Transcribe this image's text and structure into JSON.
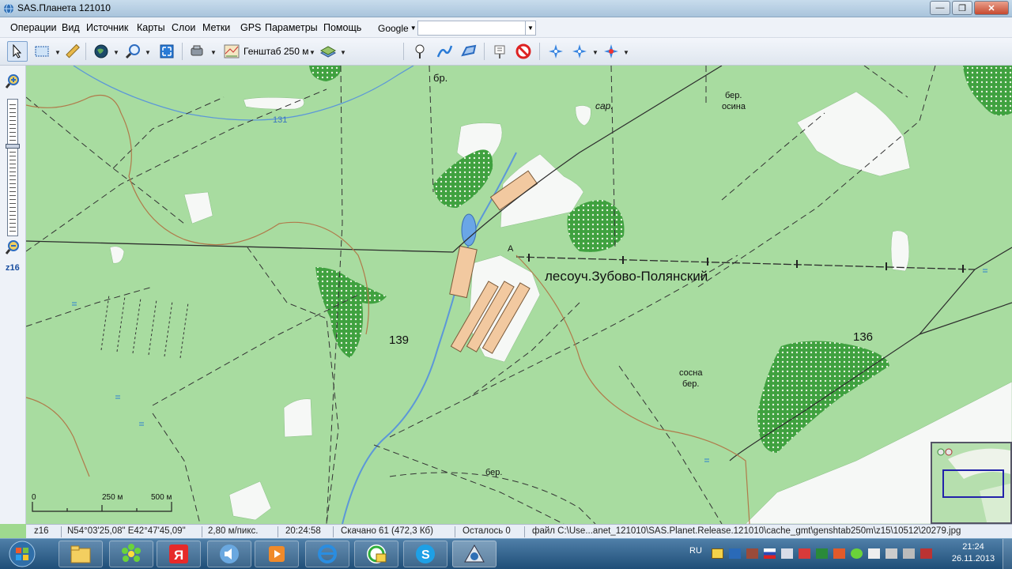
{
  "window": {
    "title": "SAS.Планета 121010"
  },
  "menu": {
    "items": [
      "Операции",
      "Вид",
      "Источник",
      "Карты",
      "Слои",
      "Метки",
      "GPS",
      "Параметры",
      "Помощь"
    ],
    "map_source": "Google",
    "search_value": ""
  },
  "toolbar": {
    "map_name": "Генштаб 250 м"
  },
  "zoom_panel": {
    "level": "z16"
  },
  "map": {
    "labels": {
      "br": "бр.",
      "sar": "сар.",
      "ber_osina_1": "бер.",
      "ber_osina_2": "осина",
      "num131": "131",
      "forestry": "лесоуч.Зубово-Полянский",
      "num139": "139",
      "num136": "136",
      "sosna_ber_1": "сосна",
      "sosna_ber_2": "бер.",
      "ber_bottom": "бер.",
      "marker_a": "А"
    },
    "scale": {
      "s0": "0",
      "s250": "250 м",
      "s500": "500 м"
    }
  },
  "statusbar": {
    "zoom": "z16",
    "coords": "N54°03'25,08\" E42°47'45,09\"",
    "resolution": "2,80 м/пикс.",
    "time": "20:24:58",
    "downloaded": "Скачано 61 (472,3 Кб)",
    "remaining": "Осталось 0",
    "file": "файл C:\\Use...anet_121010\\SAS.Planet.Release.121010\\cache_gmt\\genshtab250m\\z15\\10512\\20279.jpg"
  },
  "taskbar": {
    "lang": "RU",
    "time": "21:24",
    "date": "26.11.2013"
  },
  "colors": {
    "forest": "#a8dca0",
    "clearing": "#f4f7f4",
    "water": "#6a9fd8",
    "building": "#f2c9a0"
  }
}
